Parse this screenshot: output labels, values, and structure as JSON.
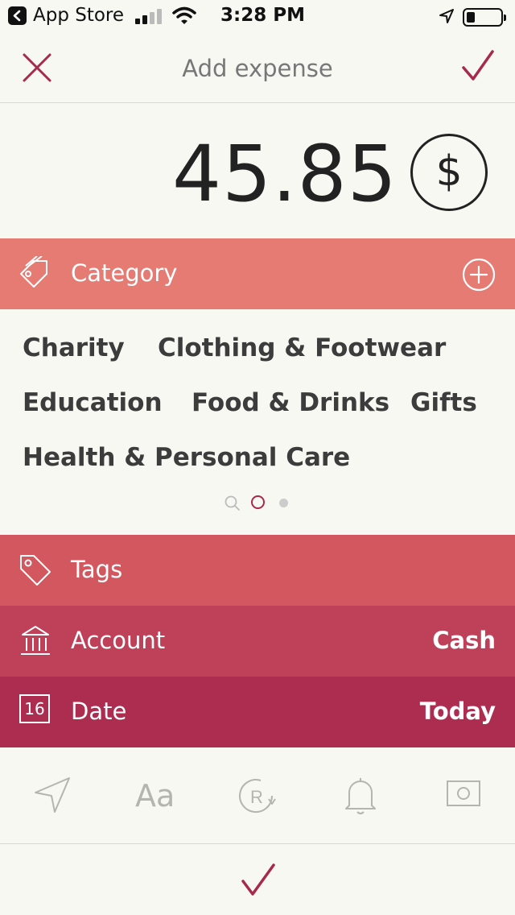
{
  "status_bar": {
    "back_app": "App Store",
    "time": "3:28 PM"
  },
  "header": {
    "title": "Add expense",
    "close_icon": "close-icon",
    "confirm_icon": "checkmark-icon"
  },
  "amount": {
    "value": "45.85",
    "currency_symbol": "$"
  },
  "category": {
    "label": "Category",
    "add_icon": "plus-circle-icon",
    "items": [
      "Charity",
      "Clothing & Footwear",
      "Education",
      "Food & Drinks",
      "Gifts",
      "Health & Personal Care"
    ],
    "page_count": 3,
    "active_page": 1
  },
  "tags": {
    "label": "Tags"
  },
  "account": {
    "label": "Account",
    "value": "Cash"
  },
  "date": {
    "label": "Date",
    "value": "Today",
    "calendar_day": "16"
  },
  "toolbar": {
    "location_icon": "location-icon",
    "text_label": "Aa",
    "recurring_icon": "recurring-icon",
    "reminder_icon": "bell-icon",
    "photo_icon": "photo-icon"
  },
  "colors": {
    "accent": "#a62a4b",
    "category_band": "#e67b73",
    "tags_band": "#d3575e",
    "account_band": "#bf4159",
    "date_band": "#ad2d51"
  }
}
